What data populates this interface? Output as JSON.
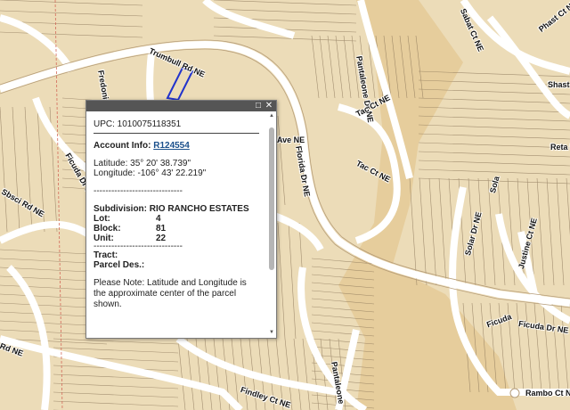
{
  "map": {
    "colors": {
      "background": "#ecdcb8",
      "parcel_line": "#7e6b52",
      "road": "#ffffff",
      "valley": "#e8cfa0",
      "selected_parcel": "#2233cc"
    },
    "street_labels": [
      {
        "text": "Trumbull Rd NE"
      },
      {
        "text": "Ave NE"
      },
      {
        "text": "Pantaleone Dr NE"
      },
      {
        "text": "Tac Ct NE"
      },
      {
        "text": "Tac Ct NE"
      },
      {
        "text": "Florida Dr NE"
      },
      {
        "text": "Sabat Ct NE"
      },
      {
        "text": "Phast Ct NE"
      },
      {
        "text": "Shast"
      },
      {
        "text": "Reta Dr"
      },
      {
        "text": "Sbsci Rd NE"
      },
      {
        "text": "Ficuda Dr NE"
      },
      {
        "text": "Rambo Ct NE"
      },
      {
        "text": "Findley Ct NE"
      },
      {
        "text": "Solar Dr NE"
      },
      {
        "text": "Justine Ct NE"
      },
      {
        "text": "Ficuda Dr NE"
      },
      {
        "text": "Fredonia St NE"
      },
      {
        "text": "Pantaleone"
      },
      {
        "text": "Rd NE"
      },
      {
        "text": "Sola"
      },
      {
        "text": "Ficuda"
      }
    ]
  },
  "popup": {
    "upc": "UPC: 1010075118351",
    "account_label": "Account Info:",
    "account_link": "R124554",
    "latitude": "Latitude: 35° 20' 38.739\"",
    "longitude": "Longitude: -106° 43' 22.219\"",
    "divider": "------------------------------",
    "subdivision": "Subdivision: RIO RANCHO ESTATES",
    "lot_label": "Lot:",
    "lot_value": "4",
    "block_label": "Block:",
    "block_value": "81",
    "unit_label": "Unit:",
    "unit_value": "22",
    "divider2": "------------------------------",
    "tract": "Tract:",
    "parcel_des": "Parcel Des.:",
    "note": "Please Note: Latitude and Longitude is the approximate center of the parcel shown.",
    "maximize_icon": "maximize-icon",
    "close_icon": "close-icon"
  }
}
